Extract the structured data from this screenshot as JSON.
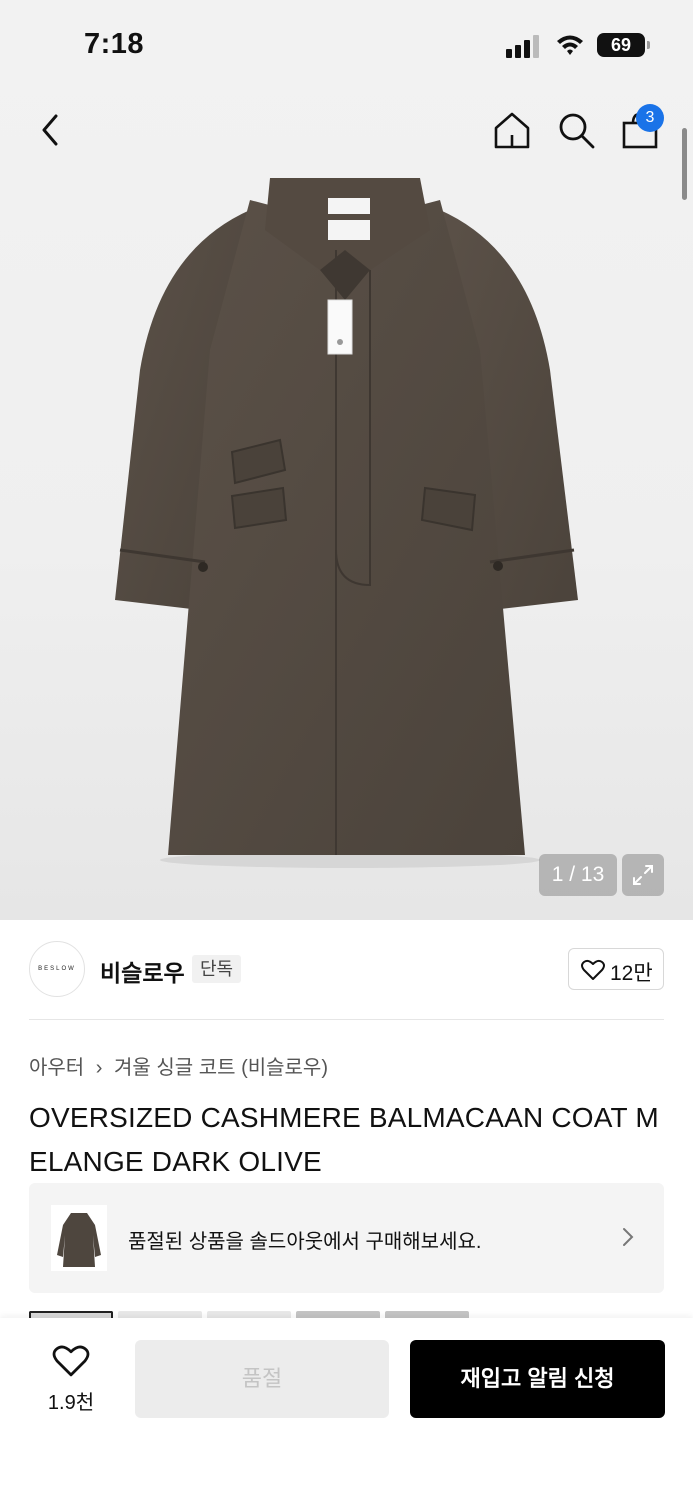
{
  "status_bar": {
    "time": "7:18",
    "battery": "69"
  },
  "nav": {
    "cart_count": "3"
  },
  "gallery": {
    "counter": "1 / 13"
  },
  "brand": {
    "logo_text": "BESLOW",
    "name": "비슬로우",
    "tag": "단독",
    "likes": "12만"
  },
  "breadcrumb": {
    "category": "아우터",
    "subcategory": "겨울 싱글 코트 (비슬로우)"
  },
  "product": {
    "title": "OVERSIZED CASHMERE BALMACAAN COAT MELANGE DARK OLIVE"
  },
  "soldout_banner": {
    "text": "품절된 상품을 솔드아웃에서 구매해보세요."
  },
  "bottom_bar": {
    "wish_count": "1.9천",
    "soldout_label": "품절",
    "restock_label": "재입고 알림 신청"
  }
}
